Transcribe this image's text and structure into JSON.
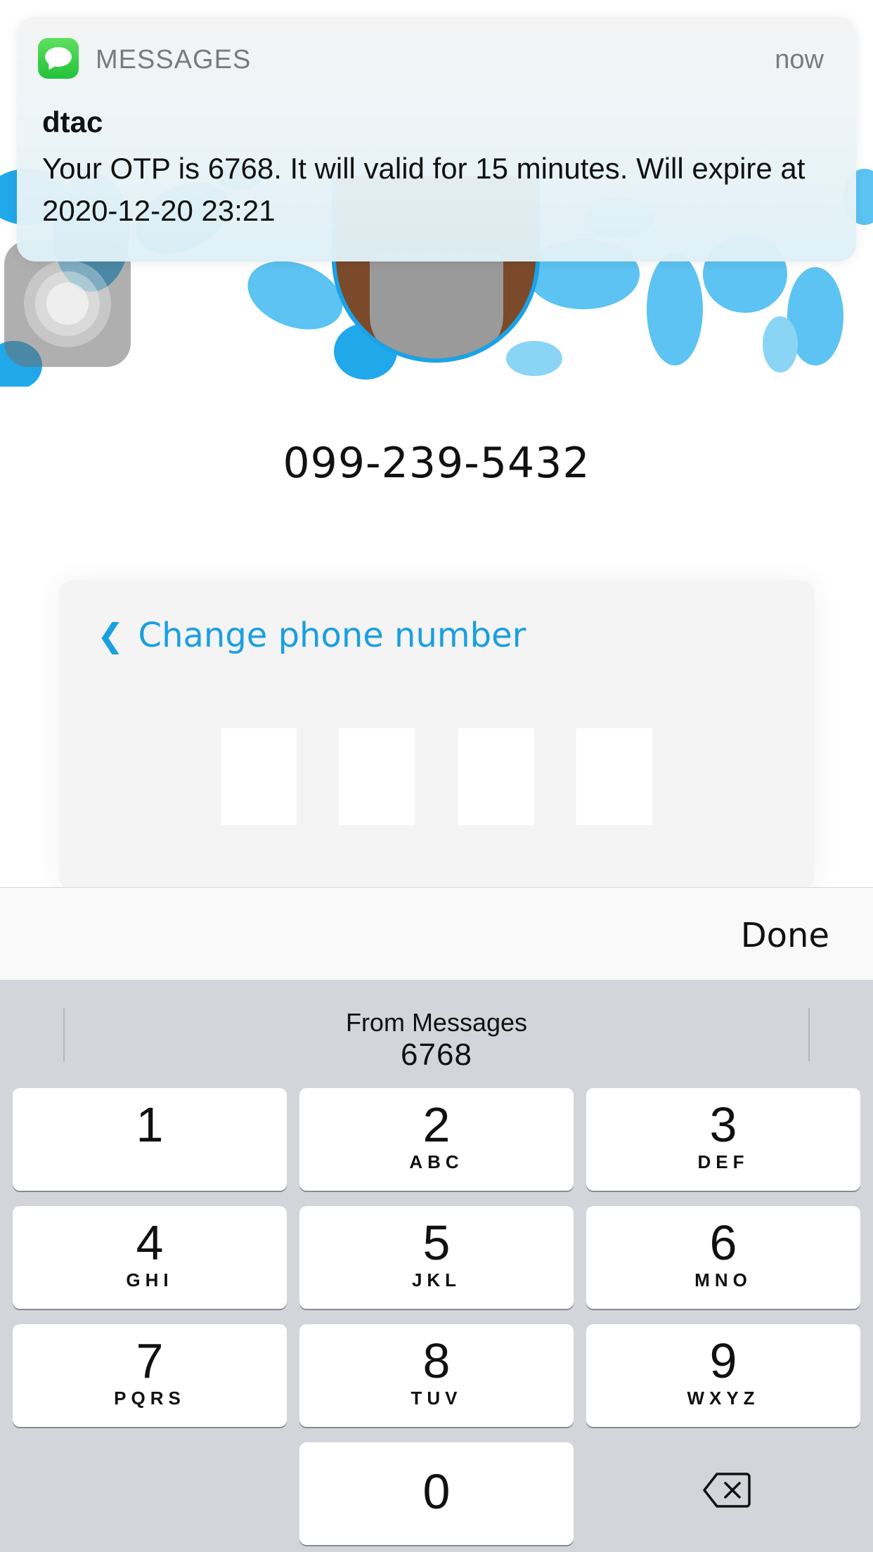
{
  "notification": {
    "app_name": "MESSAGES",
    "time": "now",
    "sender": "dtac",
    "body": "Your OTP is  6768. It will valid for 15 minutes. Will expire at 2020-12-20 23:21",
    "app_icon": "messages-app-icon"
  },
  "account": {
    "phone_number": "099-239-5432"
  },
  "otp_card": {
    "change_phone_label": "Change phone number",
    "digits": [
      "",
      "",
      "",
      ""
    ]
  },
  "accessory_bar": {
    "done_label": "Done"
  },
  "keyboard": {
    "suggestion_label": "From Messages",
    "suggestion_value": "6768",
    "keys": [
      {
        "digit": "1",
        "letters": ""
      },
      {
        "digit": "2",
        "letters": "ABC"
      },
      {
        "digit": "3",
        "letters": "DEF"
      },
      {
        "digit": "4",
        "letters": "GHI"
      },
      {
        "digit": "5",
        "letters": "JKL"
      },
      {
        "digit": "6",
        "letters": "MNO"
      },
      {
        "digit": "7",
        "letters": "PQRS"
      },
      {
        "digit": "8",
        "letters": "TUV"
      },
      {
        "digit": "9",
        "letters": "WXYZ"
      },
      {
        "digit": "0",
        "letters": ""
      }
    ],
    "backspace_icon": "backspace-icon"
  },
  "colors": {
    "accent": "#1a9fe0",
    "keyboard_bg": "#d3d5db",
    "messages_green": "#2fcc48"
  }
}
